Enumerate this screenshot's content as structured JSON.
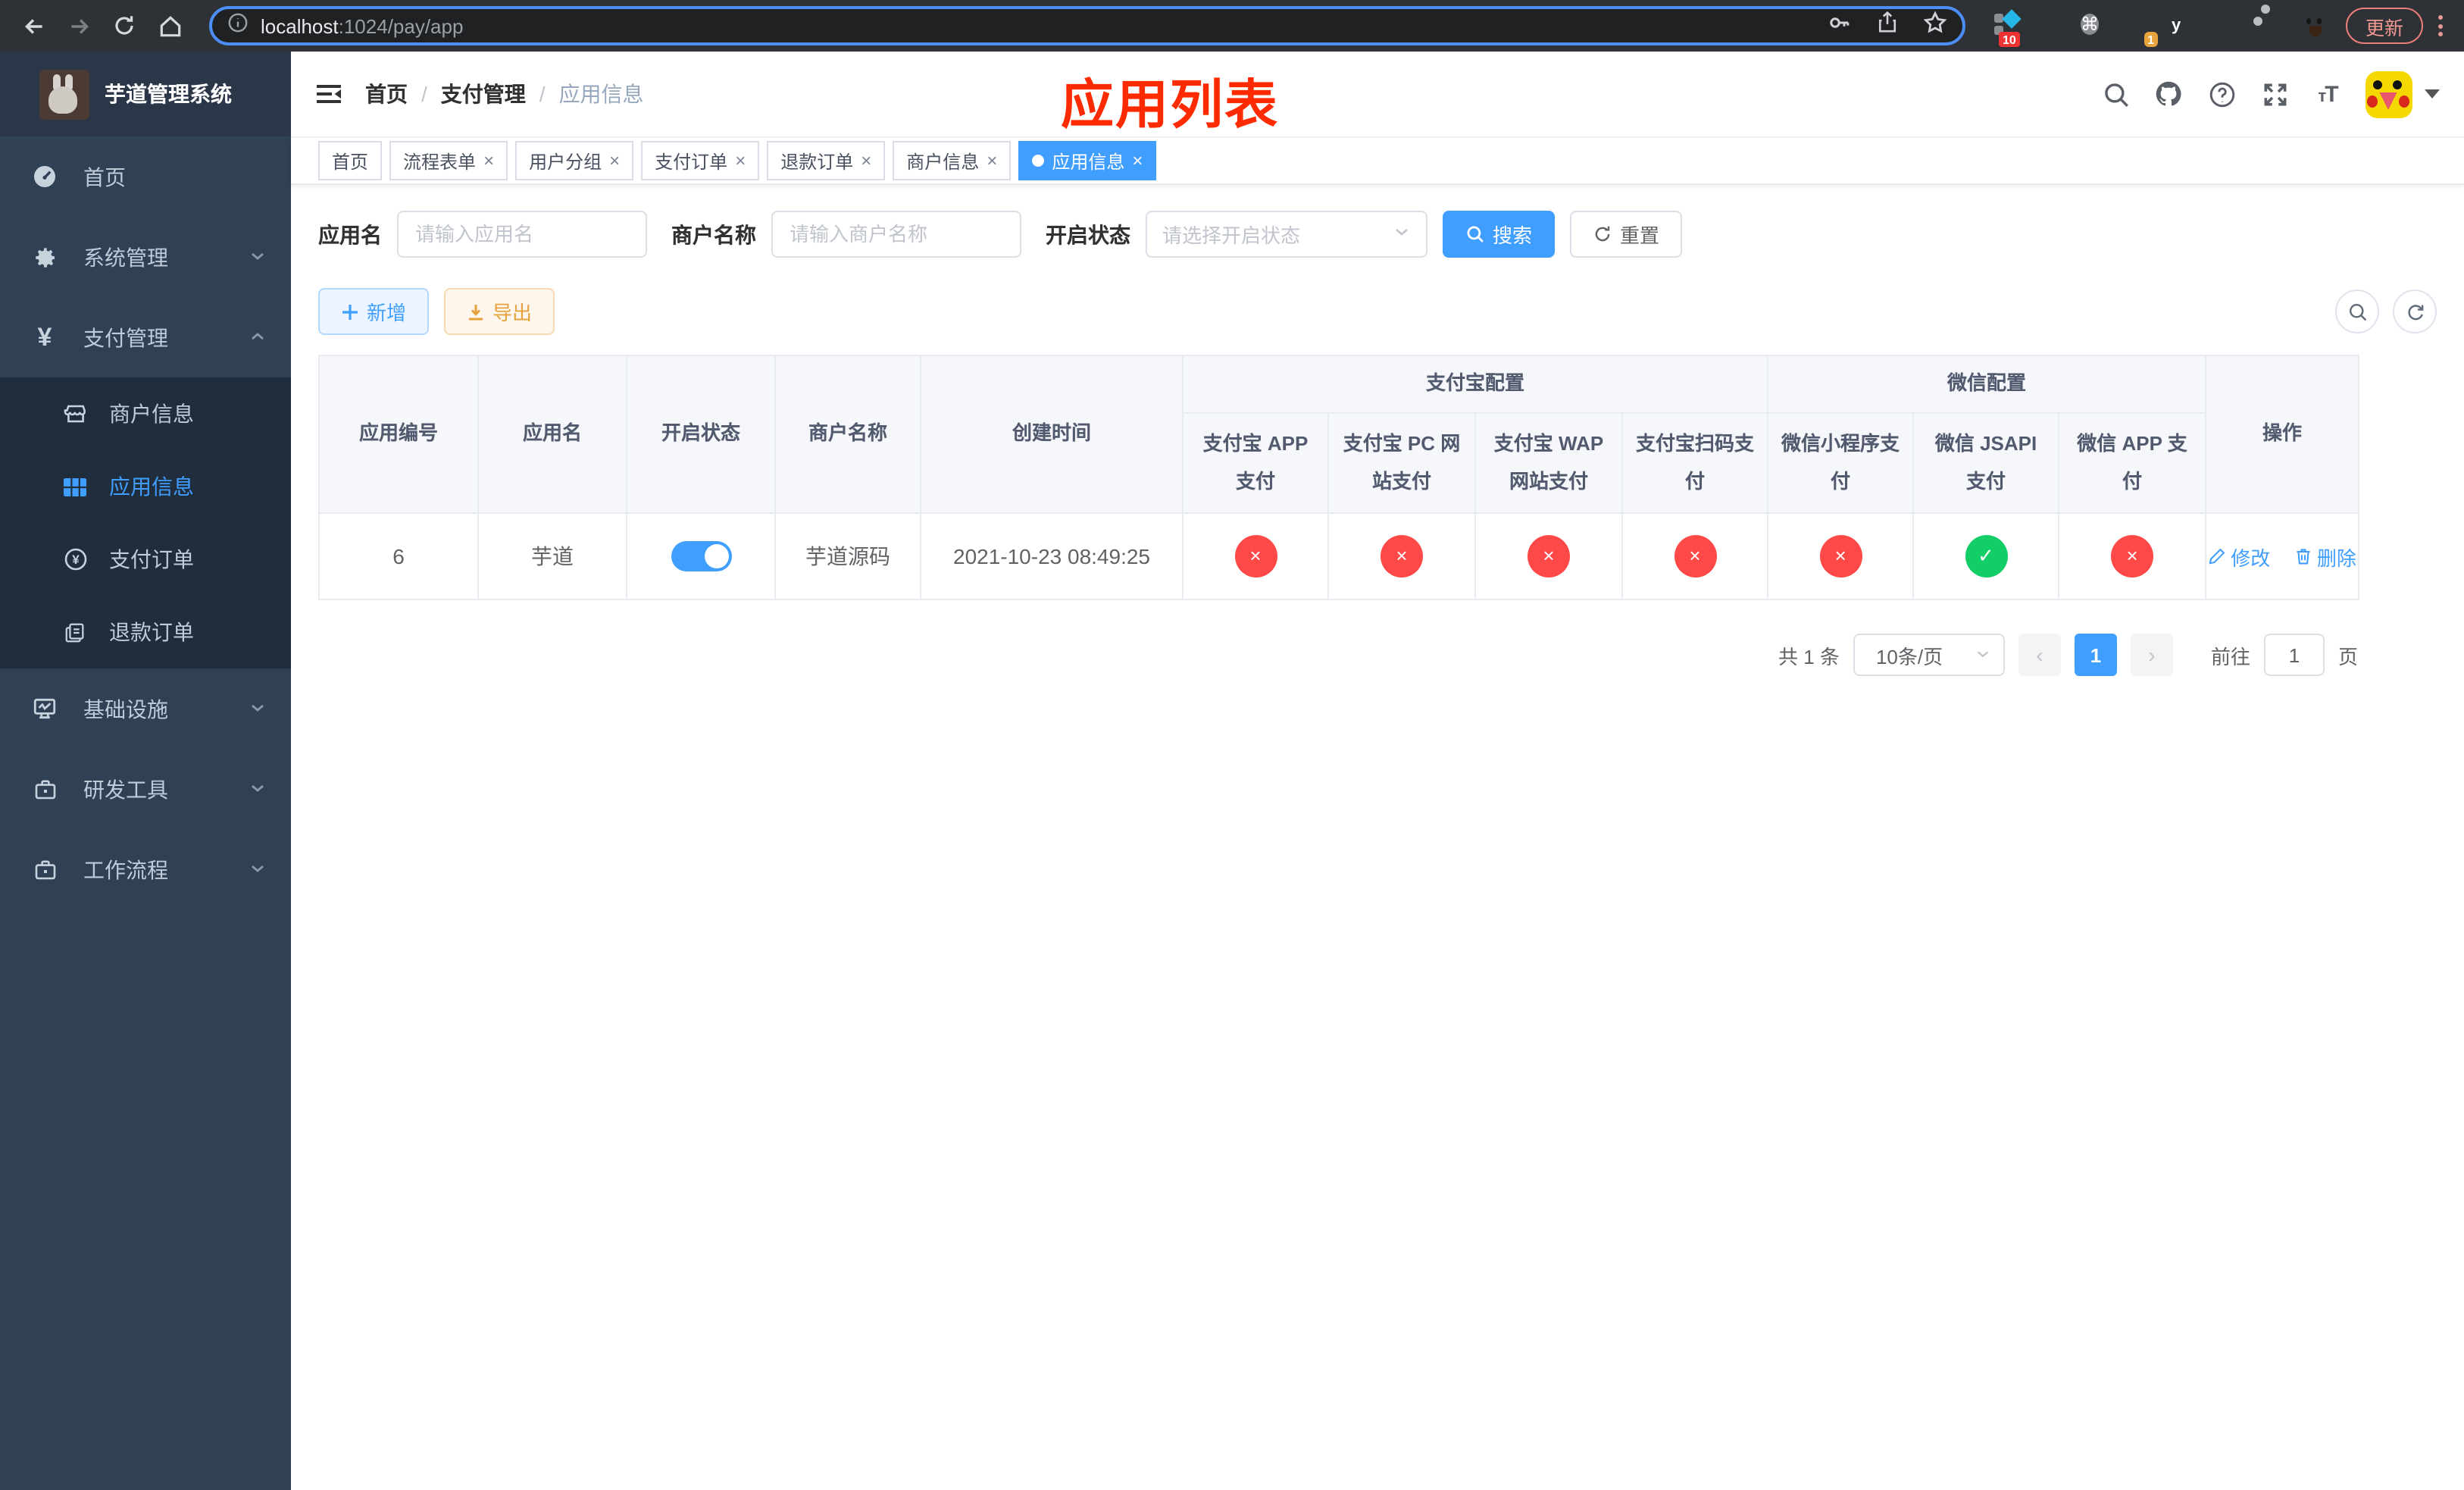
{
  "colors": {
    "accent": "#409EFF",
    "danger": "#FF4949",
    "success": "#13CE66",
    "warning": "#E6A23C",
    "sidebar_bg": "#304156",
    "submenu_bg": "#1F2D3D"
  },
  "browser": {
    "url_host": "localhost",
    "url_rest": ":1024/pay/app",
    "update_label": "更新",
    "ext_badge_ten": "10",
    "ext_badge_one": "1"
  },
  "sidebar": {
    "logo_title": "芋道管理系统",
    "items": {
      "home": {
        "label": "首页"
      },
      "system": {
        "label": "系统管理"
      },
      "payment": {
        "label": "支付管理"
      },
      "merchant": {
        "label": "商户信息"
      },
      "app_info": {
        "label": "应用信息"
      },
      "pay_order": {
        "label": "支付订单"
      },
      "refund_order": {
        "label": "退款订单"
      },
      "infra": {
        "label": "基础设施"
      },
      "dev_tools": {
        "label": "研发工具"
      },
      "workflow": {
        "label": "工作流程"
      }
    }
  },
  "breadcrumb": {
    "home": "首页",
    "section": "支付管理",
    "current": "应用信息",
    "sep": "/"
  },
  "overlay_title": "应用列表",
  "tabs": [
    {
      "label": "首页"
    },
    {
      "label": "流程表单",
      "close": "×"
    },
    {
      "label": "用户分组",
      "close": "×"
    },
    {
      "label": "支付订单",
      "close": "×"
    },
    {
      "label": "退款订单",
      "close": "×"
    },
    {
      "label": "商户信息",
      "close": "×"
    },
    {
      "label": "应用信息",
      "close": "×"
    }
  ],
  "filters": {
    "app_name": {
      "label": "应用名",
      "placeholder": "请输入应用名"
    },
    "merchant_name": {
      "label": "商户名称",
      "placeholder": "请输入商户名称"
    },
    "status": {
      "label": "开启状态",
      "placeholder": "请选择开启状态"
    },
    "search_label": "搜索",
    "reset_label": "重置"
  },
  "toolbar": {
    "add_label": "新增",
    "export_label": "导出"
  },
  "table": {
    "columns": [
      "应用编号",
      "应用名",
      "开启状态",
      "商户名称",
      "创建时间"
    ],
    "groups": [
      {
        "label": "支付宝配置",
        "cols": [
          "支付宝 APP 支付",
          "支付宝 PC 网站支付",
          "支付宝 WAP 网站支付",
          "支付宝扫码支付"
        ]
      },
      {
        "label": "微信配置",
        "cols": [
          "微信小程序支付",
          "微信 JSAPI 支付",
          "微信 APP 支付"
        ]
      }
    ],
    "ops_label": "操作"
  },
  "row": {
    "id": "6",
    "name": "芋道",
    "enabled": "on",
    "merchant": "芋道源码",
    "created": "2021-10-23 08:49:25",
    "statuses": [
      {
        "state": "no",
        "glyph": "×"
      },
      {
        "state": "no",
        "glyph": "×"
      },
      {
        "state": "no",
        "glyph": "×"
      },
      {
        "state": "no",
        "glyph": "×"
      },
      {
        "state": "no",
        "glyph": "×"
      },
      {
        "state": "yes",
        "glyph": "✓"
      },
      {
        "state": "no",
        "glyph": "×"
      }
    ],
    "edit_label": "修改",
    "delete_label": "删除"
  },
  "pagination": {
    "total": "共 1 条",
    "page_size": "10条/页",
    "prev": "‹",
    "page": "1",
    "next": "›",
    "goto_label": "前往",
    "goto_value": "1",
    "unit_label": "页"
  }
}
